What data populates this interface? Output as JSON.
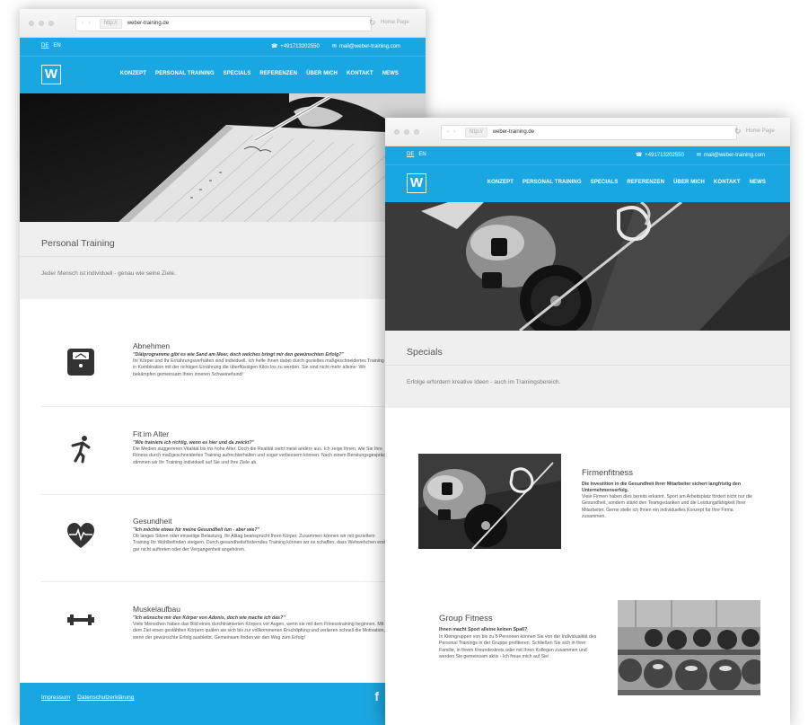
{
  "browser": {
    "url": "weber-training.de",
    "protocol": "http://",
    "nav_glyph": "‹ ›",
    "home_label": "Home Page"
  },
  "topbar": {
    "lang_de": "DE",
    "lang_en": "EN",
    "phone": "+491713202550",
    "email": "mail@weber-training.com",
    "phone_icon": "☎",
    "mail_icon": "✉"
  },
  "menu": {
    "logo": "W",
    "items": [
      "KONZEPT",
      "PERSONAL TRAINING",
      "SPECIALS",
      "REFERENZEN",
      "ÜBER MICH",
      "KONTAKT",
      "NEWS"
    ]
  },
  "back": {
    "title": "Personal Training",
    "subtitle": "Jeder Mensch ist individuell - genau wie seine Ziele.",
    "services": [
      {
        "icon": "scale-icon",
        "title": "Abnehmen",
        "quote": "\"Diätprogramme gibt es wie Sand am Meer, doch welches bringt mir den gewünschten Erfolg?\"",
        "text": "Ihr Körper und Ihr Ernährungsverhalten sind individuell. Ich helfe Ihnen dabei durch gezieltes maßgeschneidertes Training in Kombination mit der richtigen Ernährung die überflüssigen Kilos los zu werden. Sie sind nicht mehr alleine: Wir bekämpfen gemeinsam Ihren inneren Schweinehund!"
      },
      {
        "icon": "stretching-person-icon",
        "title": "Fit im Alter",
        "quote": "\"Wie trainiere ich richtig, wenn es hier und da zwickt?\"",
        "text": "Die Medien suggerieren Vitalität bis ins hohe Alter. Doch die Realität sieht meist anders aus. Ich zeige Ihnen, wie Sie Ihre Fitness durch maßgeschneidertes Training aufrechterhalten und sogar verbessern können. Nach einem Beratungsgespräch stimmen wir Ihr Training individuell auf Sie und Ihre Ziele ab."
      },
      {
        "icon": "heart-pulse-icon",
        "title": "Gesundheit",
        "quote": "\"Ich möchte etwas für meine Gesundheit tun - aber wie?\"",
        "text": "Ob langes Sitzen oder einseitige Belastung, Ihr Alltag beansprucht Ihren Körper. Zusammen können wir mit gezieltem Training Ihr Wohlbefinden steigern. Durch gesundheitsförderndes Training können wir es schaffen, dass Wehwehchen erst gar nicht auftreten oder der Vergangenheit angehören."
      },
      {
        "icon": "dumbbell-icon",
        "title": "Muskelaufbau",
        "quote": "\"Ich wünsche mir den Körper von Adonis, doch wie mache ich das?\"",
        "text": "Viele Menschen haben das Bild eines durchtrainierten Körpers vor Augen, wenn sie mit dem Fitnesstraining beginnen. Mit dem Ziel einen gestählten Körpers quälen sie sich bis zur vollkommenen Erschöpfung und verlieren schnell die Motivation, wenn der gewünschte Erfolg ausbleibt. Gemeinsam finden wir den Weg zum Erfolg!"
      }
    ],
    "footer": {
      "impressum": "Impressum",
      "datenschutz": "Datenschutzerklärung",
      "facebook": "f"
    }
  },
  "front": {
    "title": "Specials",
    "subtitle": "Erfolge erfordern kreative Ideen - auch im Trainingsbereich.",
    "features": [
      {
        "title": "Firmenfitness",
        "quote": "Die Investition in die Gesundheit Ihrer Mitarbeiter sichert langfristig den Unternehmenserfolg.",
        "text": "Viele Firmen haben dies bereits erkannt. Sport am Arbeitsplatz fördert nicht nur die Gesundheit, sondern stärkt den Teamgedanken und die Leistungsfähigkeit Ihrer Mitarbeiter. Gerne stelle ich Ihnen ein individuelles Konzept für Ihre Firma zusammen."
      },
      {
        "title": "Group Fitness",
        "quote": "Ihnen macht Sport alleine keinen Spaß?",
        "text": "In Kleingruppen von bis zu 5 Personen können Sie von der Individualität des Personal Trainings in der Gruppe profitieren. Schließen Sie sich in Ihrer Familie, in Ihrem Freundeskreis oder mit Ihren Kollegen zusammen und werden Sie gemeinsam aktiv - Ich freue mich auf Sie!"
      }
    ]
  }
}
